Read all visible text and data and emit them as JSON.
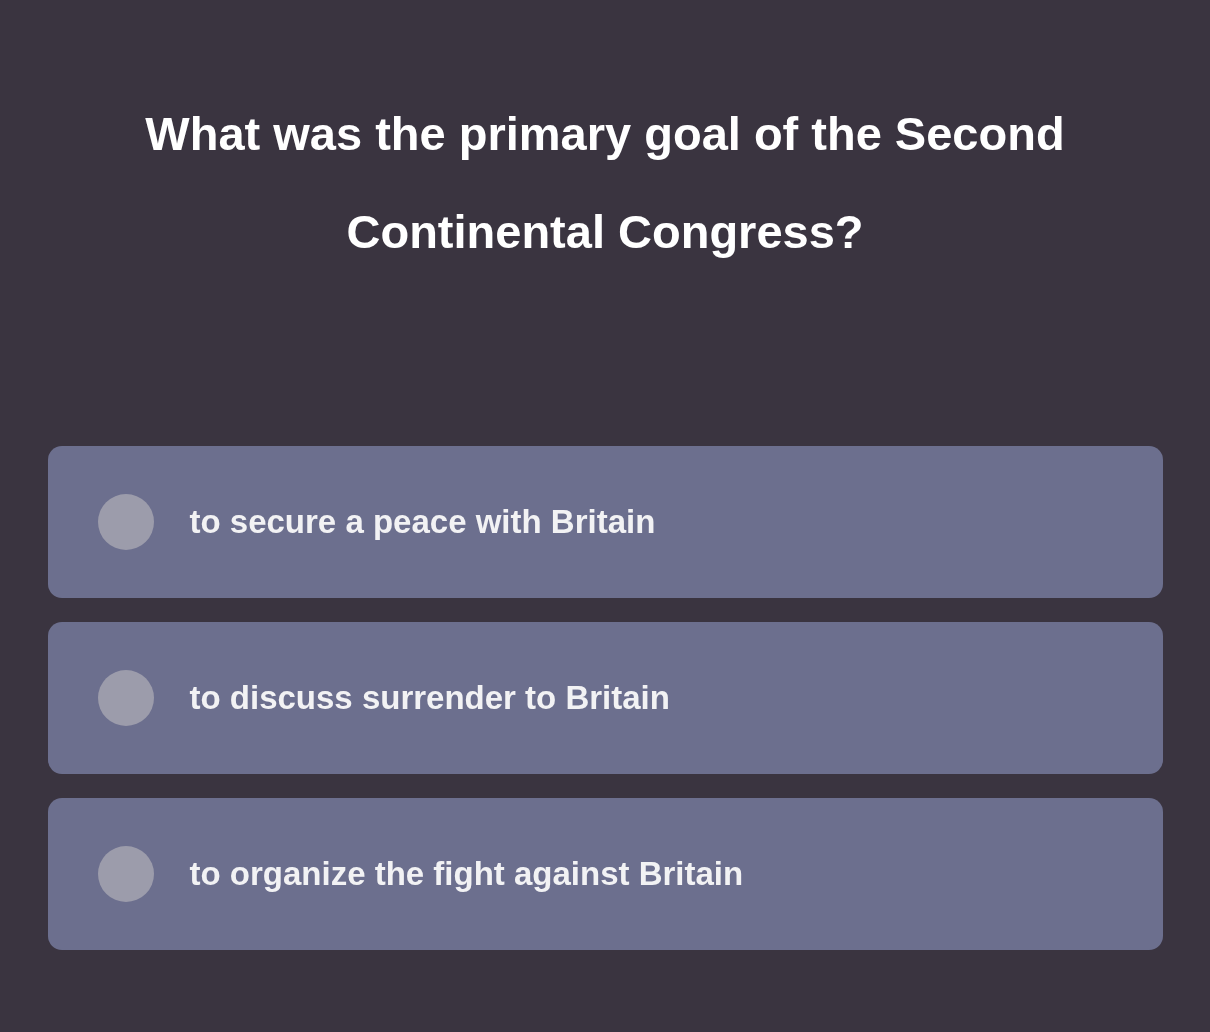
{
  "question": "What was the primary goal of the Second Continental Congress?",
  "options": [
    {
      "label": "to secure a peace with Britain",
      "selected": false
    },
    {
      "label": "to discuss surrender to Britain",
      "selected": false
    },
    {
      "label": "to organize the fight against Britain",
      "selected": false
    }
  ]
}
